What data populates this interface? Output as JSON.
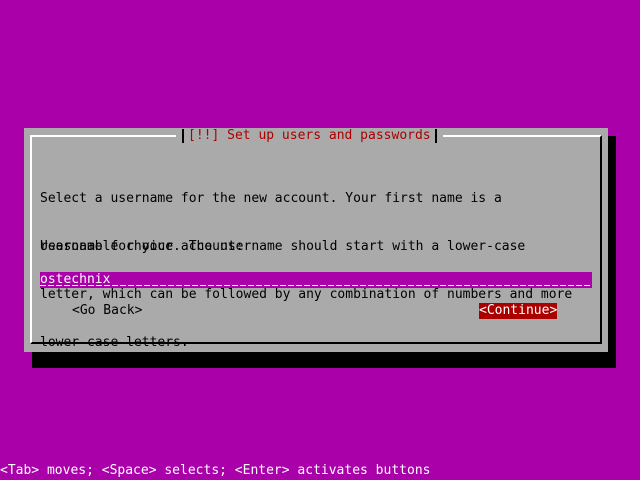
{
  "dialog": {
    "title": "[!!] Set up users and passwords",
    "description_lines": [
      "Select a username for the new account. Your first name is a",
      "reasonable choice. The username should start with a lower-case",
      "letter, which can be followed by any combination of numbers and more",
      "lower-case letters."
    ],
    "field_label": "Username for your account:",
    "username_value": "ostechnix",
    "go_back_label": "<Go Back>",
    "continue_label": "<Continue>"
  },
  "footer": {
    "help_text": "<Tab> moves; <Space> selects; <Enter> activates buttons"
  },
  "colors": {
    "background": "#aa00aa",
    "dialog": "#aaaaaa",
    "title_text": "#aa0000",
    "selected_button_bg": "#aa0000",
    "selected_button_text": "#ffffff",
    "input_bg": "#aa00aa",
    "help_text": "#ffffff"
  }
}
